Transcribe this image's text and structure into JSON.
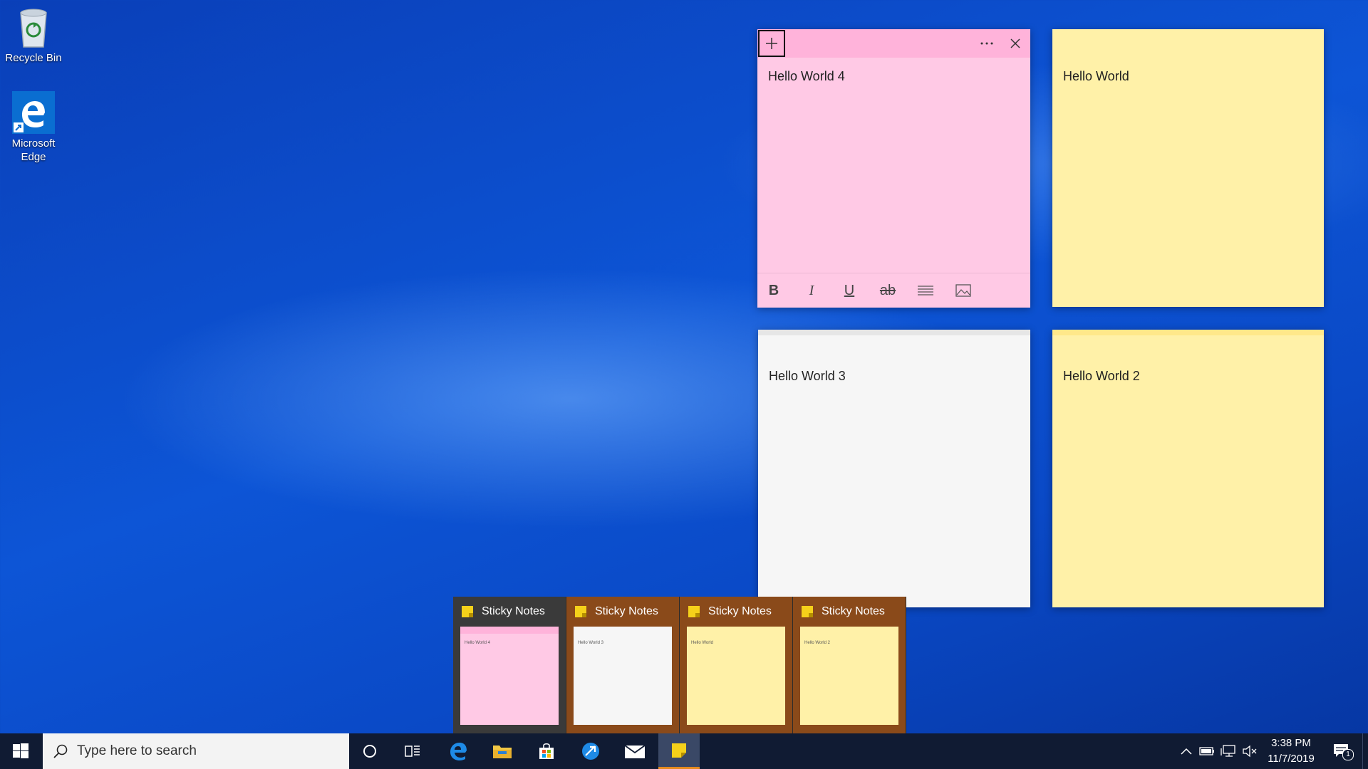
{
  "desktop": {
    "icons": [
      {
        "label": "Recycle Bin",
        "icon": "recycle-bin-icon"
      },
      {
        "label": "Microsoft Edge",
        "label_line1": "Microsoft",
        "label_line2": "Edge",
        "icon": "edge-icon"
      }
    ]
  },
  "notes": [
    {
      "text": "Hello World 4",
      "color": "#ffc9e5",
      "active": true
    },
    {
      "text": "Hello World",
      "color": "#fff1a8"
    },
    {
      "text": "Hello World 3",
      "color": "#f6f6f6"
    },
    {
      "text": "Hello World 2",
      "color": "#fff1a8"
    }
  ],
  "formatting_toolbar": {
    "bold": "B",
    "italic": "I",
    "underline": "U",
    "strikethrough": "ab"
  },
  "thumbnails": [
    {
      "title": "Sticky Notes",
      "preview_text": "Hello World 4",
      "preview_color": "#ffc9e5"
    },
    {
      "title": "Sticky Notes",
      "preview_text": "Hello World 3",
      "preview_color": "#f6f6f6"
    },
    {
      "title": "Sticky Notes",
      "preview_text": "Hello World",
      "preview_color": "#fff1a8"
    },
    {
      "title": "Sticky Notes",
      "preview_text": "Hello World 2",
      "preview_color": "#fff1a8"
    }
  ],
  "taskbar": {
    "search_placeholder": "Type here to search",
    "time": "3:38 PM",
    "date": "11/7/2019",
    "notification_count": "1",
    "pinned": [
      "cortana-icon",
      "task-view-icon",
      "edge-icon",
      "file-explorer-icon",
      "store-icon",
      "app-icon",
      "mail-icon",
      "sticky-notes-icon"
    ]
  },
  "colors": {
    "taskbar": "#101b33",
    "accent": "#e58a1f",
    "pink_note": "#ffc9e5",
    "yellow_note": "#fff1a8"
  }
}
